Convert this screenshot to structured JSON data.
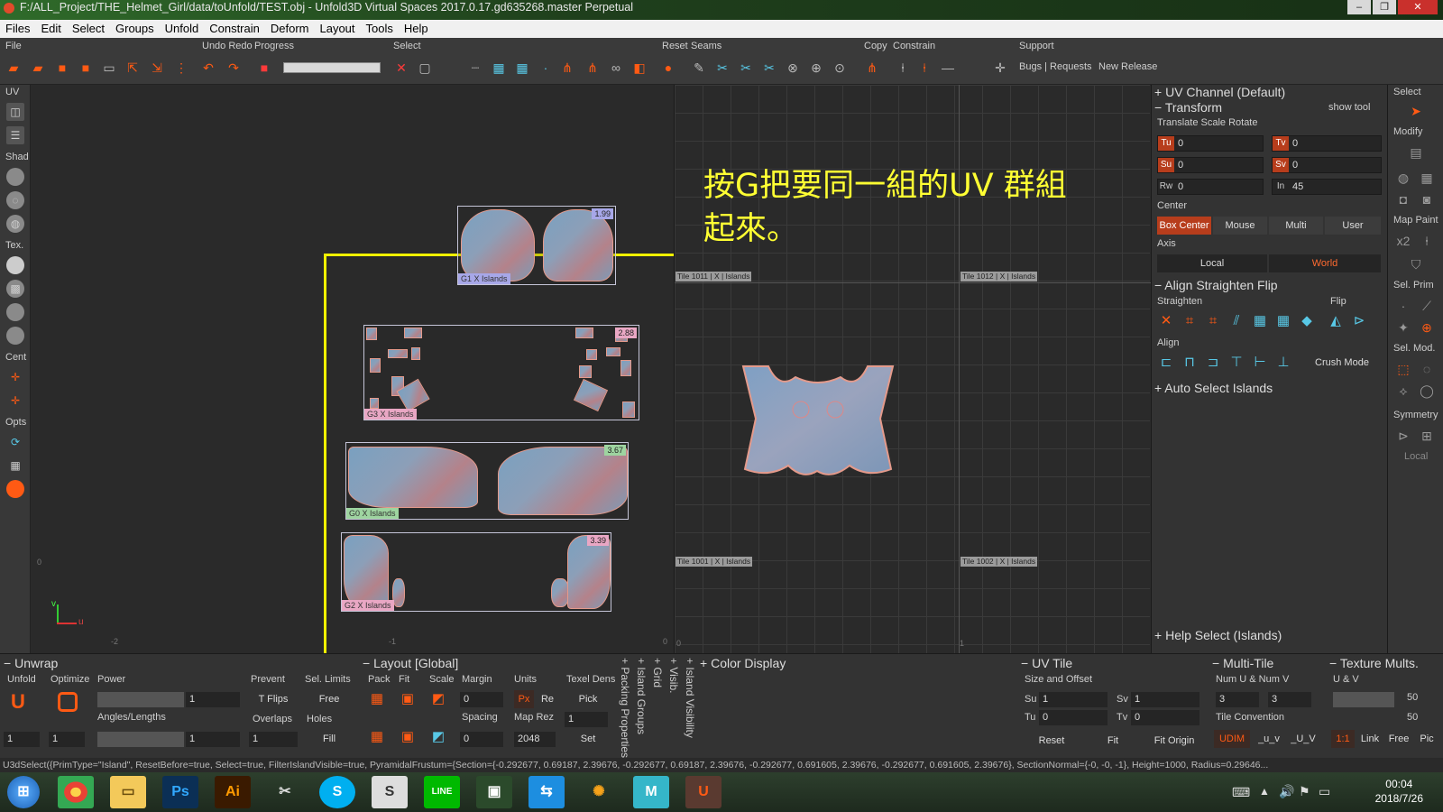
{
  "titlebar": {
    "title": "F:/ALL_Project/THE_Helmet_Girl/data/toUnfold/TEST.obj - Unfold3D Virtual Spaces 2017.0.17.gd635268.master Perpetual"
  },
  "menu": [
    "Files",
    "Edit",
    "Select",
    "Groups",
    "Unfold",
    "Constrain",
    "Deform",
    "Layout",
    "Tools",
    "Help"
  ],
  "toolbar": {
    "groups": {
      "file": "File",
      "undo": "Undo Redo",
      "progress": "Progress",
      "select": "Select",
      "reset": "Reset",
      "seams": "Seams",
      "copy": "Copy",
      "constrain": "Constrain",
      "support": "Support"
    },
    "bugs_label": "Bugs | Requests",
    "new_release_label": "New Release"
  },
  "lefttb": {
    "uv": "UV",
    "shad": "Shad",
    "tex": "Tex.",
    "cent": "Cent",
    "opts": "Opts"
  },
  "viewport_left": {
    "axis_v": "v",
    "axis_u": "u",
    "islands": [
      {
        "label": "G1  X  Islands",
        "scale": "1.99"
      },
      {
        "label": "G3  X  Islands",
        "scale": "2.88"
      },
      {
        "label": "G0  X  Islands",
        "scale": "3.67"
      },
      {
        "label": "G2  X  Islands",
        "scale": "3.39"
      }
    ],
    "ruler": [
      "-2",
      "-1",
      "0",
      "0"
    ]
  },
  "viewport_right": {
    "note": "按G把要同一組的UV 群組\n起來。",
    "tiles": [
      "Tile 1011 | X | Islands",
      "Tile 1012 | X | Islands",
      "Tile 1001 | X | Islands",
      "Tile 1002 | X | Islands"
    ],
    "ruler": [
      "0",
      "1"
    ]
  },
  "rpanel": {
    "uv_channel": "UV Channel (Default)",
    "transform": "Transform",
    "show_tool": "show tool",
    "tsr": "Translate Scale Rotate",
    "tu": {
      "label": "Tu",
      "value": "0"
    },
    "tv": {
      "label": "Tv",
      "value": "0"
    },
    "su": {
      "label": "Su",
      "value": "0"
    },
    "sv": {
      "label": "Sv",
      "value": "0"
    },
    "rw": {
      "label": "Rw",
      "value": "0"
    },
    "in": {
      "label": "In",
      "value": "45"
    },
    "center": "Center",
    "center_opts": [
      "Box Center",
      "Mouse",
      "Multi",
      "User"
    ],
    "axis": "Axis",
    "axis_opts": [
      "Local",
      "World"
    ],
    "align_sec": "Align Straighten Flip",
    "straighten": "Straighten",
    "flip": "Flip",
    "align": "Align",
    "crush": "Crush Mode",
    "auto_select": "Auto Select Islands",
    "help_select": "Help Select (Islands)"
  },
  "frstrip": {
    "select": "Select",
    "modify": "Modify",
    "map_paint": "Map Paint",
    "sel_prim": "Sel. Prim",
    "sel_mod": "Sel. Mod.",
    "symmetry": "Symmetry",
    "local": "Local"
  },
  "bottom": {
    "unwrap": {
      "title": "Unwrap",
      "unfold": "Unfold",
      "optimize": "Optimize",
      "power": "Power",
      "power_val": "1",
      "angles": "Angles/Lengths",
      "angles_val": "1",
      "prevent": "Prevent",
      "tflips": "T Flips",
      "overlaps": "Overlaps",
      "overlaps_val": "1",
      "sel_limits": "Sel. Limits",
      "free": "Free",
      "holes": "Holes",
      "fill": "Fill",
      "unfold_n": "1",
      "optimize_n": "1"
    },
    "layout": {
      "title": "Layout [Global]",
      "pack": "Pack",
      "fit": "Fit",
      "scale": "Scale",
      "margin": "Margin",
      "margin_val": "0",
      "units": "Units",
      "px": "Px",
      "re": "Re",
      "texel": "Texel Dens",
      "pick": "Pick",
      "spacing": "Spacing",
      "spacing_val": "0",
      "maprez": "Map Rez",
      "maprez_val": "2048",
      "one": "1",
      "set": "Set"
    },
    "vert": [
      "Packing Properties",
      "Island Groups",
      "Grid",
      "Visib.",
      "Island Visibility"
    ],
    "color_display": "Color Display",
    "uvtile": {
      "title": "UV Tile",
      "size": "Size and Offset",
      "su": "Su",
      "su_val": "1",
      "sv": "Sv",
      "sv_val": "1",
      "tu": "Tu",
      "tu_val": "0",
      "tv": "Tv",
      "tv_val": "0",
      "reset": "Reset",
      "fit": "Fit",
      "fit_origin": "Fit Origin"
    },
    "multitile": {
      "title": "Multi-Tile",
      "num": "Num U & Num V",
      "u": "3",
      "v": "3",
      "conv": "Tile Convention",
      "udim": "UDIM",
      "uv1": "_u_v",
      "uv2": "_U_V"
    },
    "texmult": {
      "title": "Texture Mults.",
      "uv": "U & V",
      "v1": "50",
      "v2": "50",
      "ratio": "1:1",
      "link": "Link",
      "free": "Free",
      "pic": "Pic"
    }
  },
  "status": "U3dSelect({PrimType=\"Island\", ResetBefore=true, Select=true, FilterIslandVisible=true, PyramidalFrustum={Section={-0.292677, 0.69187, 2.39676, -0.292677, 0.69187, 2.39676, -0.292677, 0.691605, 2.39676, -0.292677, 0.691605, 2.39676}, SectionNormal={-0, -0, -1}, Height=1000, Radius=0.29646...",
  "taskbar": {
    "apps": [
      "Ps",
      "Ai",
      "S",
      "M"
    ],
    "time": "00:04",
    "date": "2018/7/26"
  }
}
